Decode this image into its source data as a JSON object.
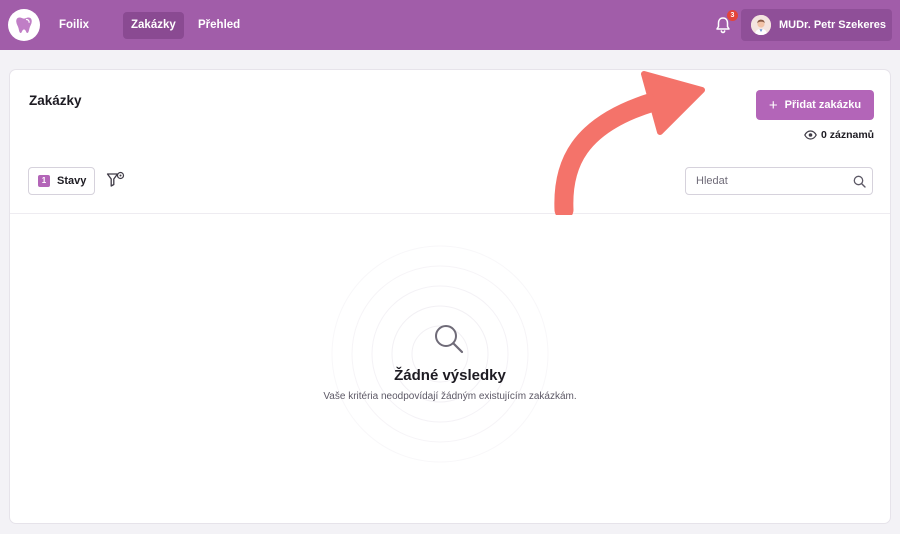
{
  "nav": {
    "app_name": "Foilix",
    "tabs": [
      {
        "label": "Zakázky",
        "active": true
      },
      {
        "label": "Přehled",
        "active": false
      }
    ],
    "notification_count": "3",
    "user_name": "MUDr. Petr Szekeres",
    "logo_icon": "tooth-icon"
  },
  "page": {
    "title": "Zakázky",
    "add_button_label": "Přidat zakázku",
    "records_label": "0 záznamů"
  },
  "filters": {
    "active_count": "1",
    "status_filter_label": "Stavy"
  },
  "search": {
    "placeholder": "Hledat",
    "value": ""
  },
  "empty_state": {
    "title": "Žádné výsledky",
    "description": "Vaše kritéria neodpovídají žádným existujícím zakázkám."
  },
  "colors": {
    "brand": "#a15da9",
    "accent": "#b365b8",
    "annotation_arrow": "#f4736a",
    "notification_badge": "#e3443a"
  }
}
